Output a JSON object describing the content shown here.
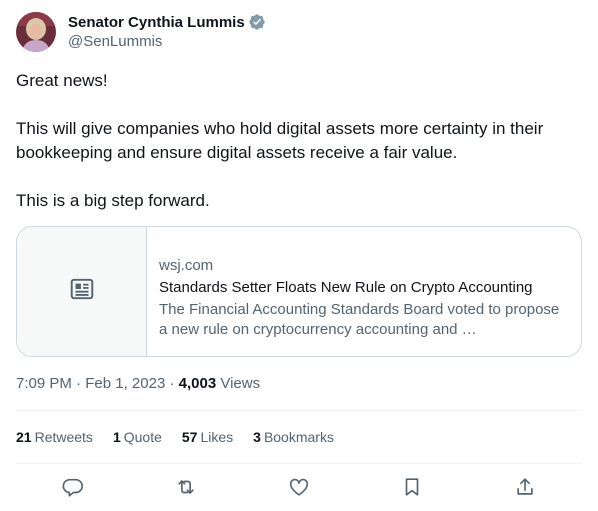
{
  "author": {
    "display_name": "Senator Cynthia Lummis",
    "handle": "@SenLummis",
    "verified_icon": "verified-badge-icon",
    "verified_color": "#829aab"
  },
  "tweet": {
    "lines": [
      "Great news!",
      "This will give companies who hold digital assets more certainty in their bookkeeping and ensure digital assets receive a fair value.",
      "This is a big step forward."
    ]
  },
  "link_card": {
    "domain": "wsj.com",
    "title": "Standards Setter Floats New Rule on Crypto Accounting",
    "description": "The Financial Accounting Standards Board voted to propose a new rule on cryptocurrency accounting and …",
    "thumbnail_icon": "article-icon"
  },
  "meta": {
    "time": "7:09 PM",
    "date": "Feb 1, 2023",
    "sep": "·",
    "views_count": "4,003",
    "views_label": "Views"
  },
  "stats": {
    "retweets": {
      "count": "21",
      "label": "Retweets"
    },
    "quotes": {
      "count": "1",
      "label": "Quote"
    },
    "likes": {
      "count": "57",
      "label": "Likes"
    },
    "bookmarks": {
      "count": "3",
      "label": "Bookmarks"
    }
  },
  "actions": [
    "reply-icon",
    "retweet-icon",
    "like-icon",
    "bookmark-icon",
    "share-icon"
  ],
  "colors": {
    "text": "#0f1419",
    "secondary": "#536471",
    "border": "#cfd9de",
    "divider": "#eff3f4"
  }
}
